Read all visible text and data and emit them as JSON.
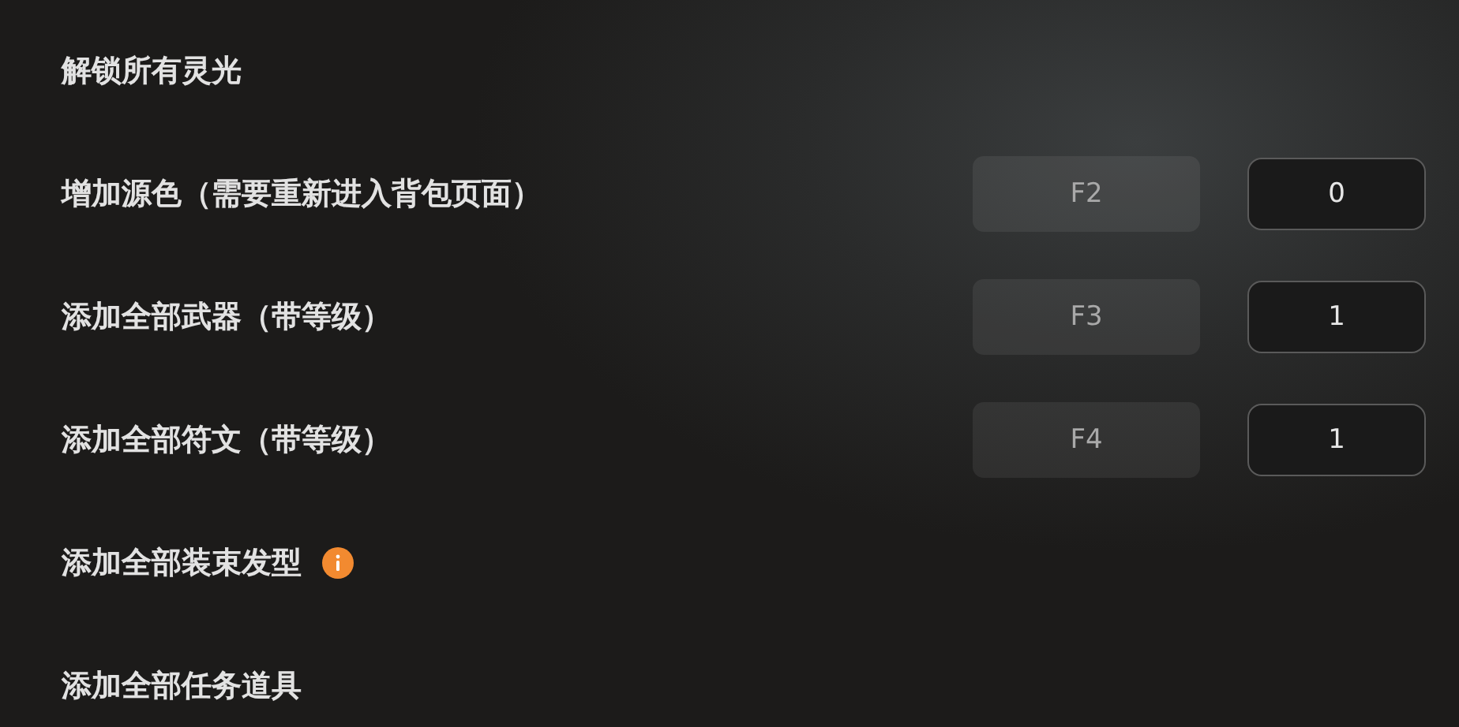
{
  "options": [
    {
      "kind": "plain",
      "label": "解锁所有灵光"
    },
    {
      "kind": "hotkey",
      "label": "增加源色（需要重新进入背包页面）",
      "hotkey": "F2",
      "value": "0"
    },
    {
      "kind": "hotkey",
      "label": "添加全部武器（带等级）",
      "hotkey": "F3",
      "value": "1"
    },
    {
      "kind": "hotkey",
      "label": "添加全部符文（带等级）",
      "hotkey": "F4",
      "value": "1"
    },
    {
      "kind": "info",
      "label": "添加全部装束发型"
    },
    {
      "kind": "plain",
      "label": "添加全部任务道具"
    }
  ]
}
